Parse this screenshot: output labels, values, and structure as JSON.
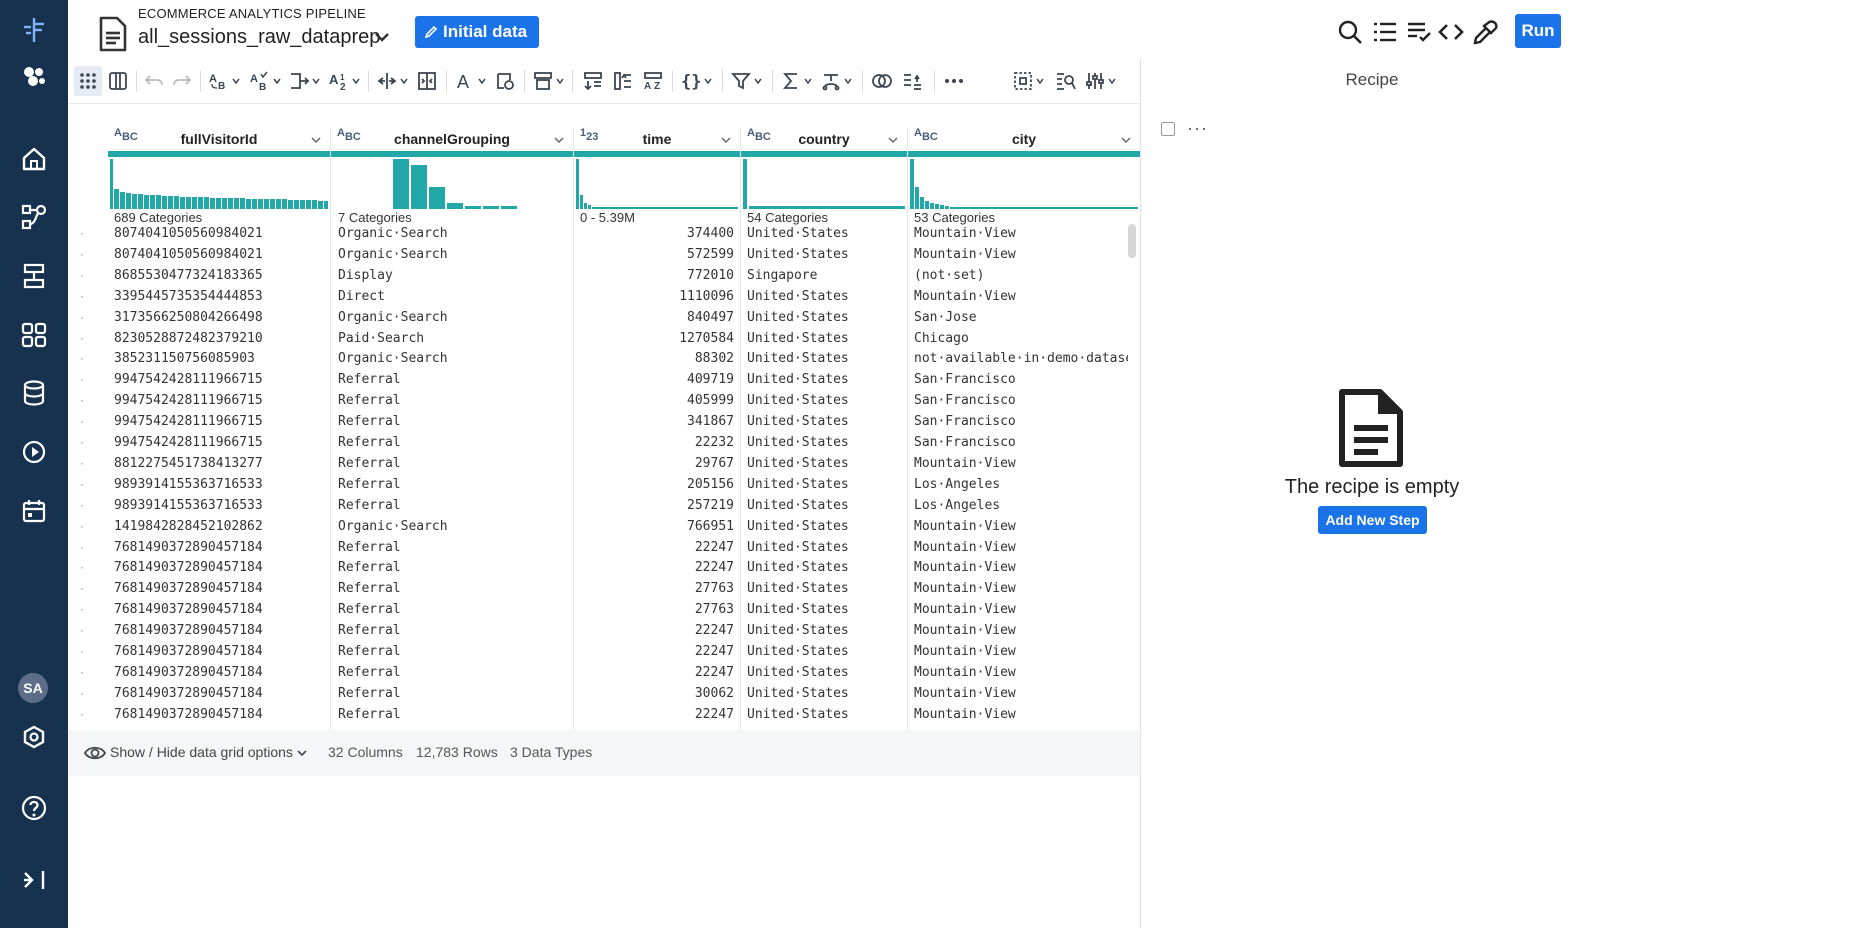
{
  "header": {
    "flow_name": "ECOMMERCE ANALYTICS PIPELINE",
    "recipe_name": "all_sessions_raw_dataprep",
    "initial_data_label": "Initial data",
    "run_label": "Run"
  },
  "nav": {
    "avatar_initials": "SA"
  },
  "recipe": {
    "title": "Recipe",
    "more": "···",
    "empty_text": "The recipe is empty",
    "add_step_label": "Add New Step"
  },
  "columns": [
    {
      "name": "fullVisitorId",
      "type_top": "A",
      "type_sub": "BC",
      "summary": "689 Categories"
    },
    {
      "name": "channelGrouping",
      "type_top": "A",
      "type_sub": "BC",
      "summary": "7 Categories"
    },
    {
      "name": "time",
      "type_top": "1",
      "type_sub": "23",
      "summary": "0 - 5.39M"
    },
    {
      "name": "country",
      "type_top": "A",
      "type_sub": "BC",
      "summary": "54 Categories"
    },
    {
      "name": "city",
      "type_top": "A",
      "type_sub": "BC",
      "summary": "53 Categories"
    }
  ],
  "rows": [
    [
      "8074041050560984021",
      "Organic·Search",
      "374400",
      "United·States",
      "Mountain·View"
    ],
    [
      "8074041050560984021",
      "Organic·Search",
      "572599",
      "United·States",
      "Mountain·View"
    ],
    [
      "8685530477324183365",
      "Display",
      "772010",
      "Singapore",
      "(not·set)"
    ],
    [
      "3395445735354444853",
      "Direct",
      "1110096",
      "United·States",
      "Mountain·View"
    ],
    [
      "3173566250804266498",
      "Organic·Search",
      "840497",
      "United·States",
      "San·Jose"
    ],
    [
      "8230528872482379210",
      "Paid·Search",
      "1270584",
      "United·States",
      "Chicago"
    ],
    [
      "385231150756085903",
      "Organic·Search",
      "88302",
      "United·States",
      "not·available·in·demo·dataset"
    ],
    [
      "9947542428111966715",
      "Referral",
      "409719",
      "United·States",
      "San·Francisco"
    ],
    [
      "9947542428111966715",
      "Referral",
      "405999",
      "United·States",
      "San·Francisco"
    ],
    [
      "9947542428111966715",
      "Referral",
      "341867",
      "United·States",
      "San·Francisco"
    ],
    [
      "9947542428111966715",
      "Referral",
      "22232",
      "United·States",
      "San·Francisco"
    ],
    [
      "8812275451738413277",
      "Referral",
      "29767",
      "United·States",
      "Mountain·View"
    ],
    [
      "9893914155363716533",
      "Referral",
      "205156",
      "United·States",
      "Los·Angeles"
    ],
    [
      "9893914155363716533",
      "Referral",
      "257219",
      "United·States",
      "Los·Angeles"
    ],
    [
      "1419842828452102862",
      "Organic·Search",
      "766951",
      "United·States",
      "Mountain·View"
    ],
    [
      "7681490372890457184",
      "Referral",
      "22247",
      "United·States",
      "Mountain·View"
    ],
    [
      "7681490372890457184",
      "Referral",
      "22247",
      "United·States",
      "Mountain·View"
    ],
    [
      "7681490372890457184",
      "Referral",
      "27763",
      "United·States",
      "Mountain·View"
    ],
    [
      "7681490372890457184",
      "Referral",
      "27763",
      "United·States",
      "Mountain·View"
    ],
    [
      "7681490372890457184",
      "Referral",
      "22247",
      "United·States",
      "Mountain·View"
    ],
    [
      "7681490372890457184",
      "Referral",
      "22247",
      "United·States",
      "Mountain·View"
    ],
    [
      "7681490372890457184",
      "Referral",
      "22247",
      "United·States",
      "Mountain·View"
    ],
    [
      "7681490372890457184",
      "Referral",
      "30062",
      "United·States",
      "Mountain·View"
    ],
    [
      "7681490372890457184",
      "Referral",
      "22247",
      "United·States",
      "Mountain·View"
    ]
  ],
  "footer": {
    "toggle_label": "Show / Hide data grid options",
    "columns_count": "32 Columns",
    "rows_count": "12,783 Rows",
    "types_count": "3 Data Types"
  },
  "colors": {
    "nav_bg": "#16324f",
    "accent": "#1a73e8",
    "histogram": "#22a8a8"
  }
}
